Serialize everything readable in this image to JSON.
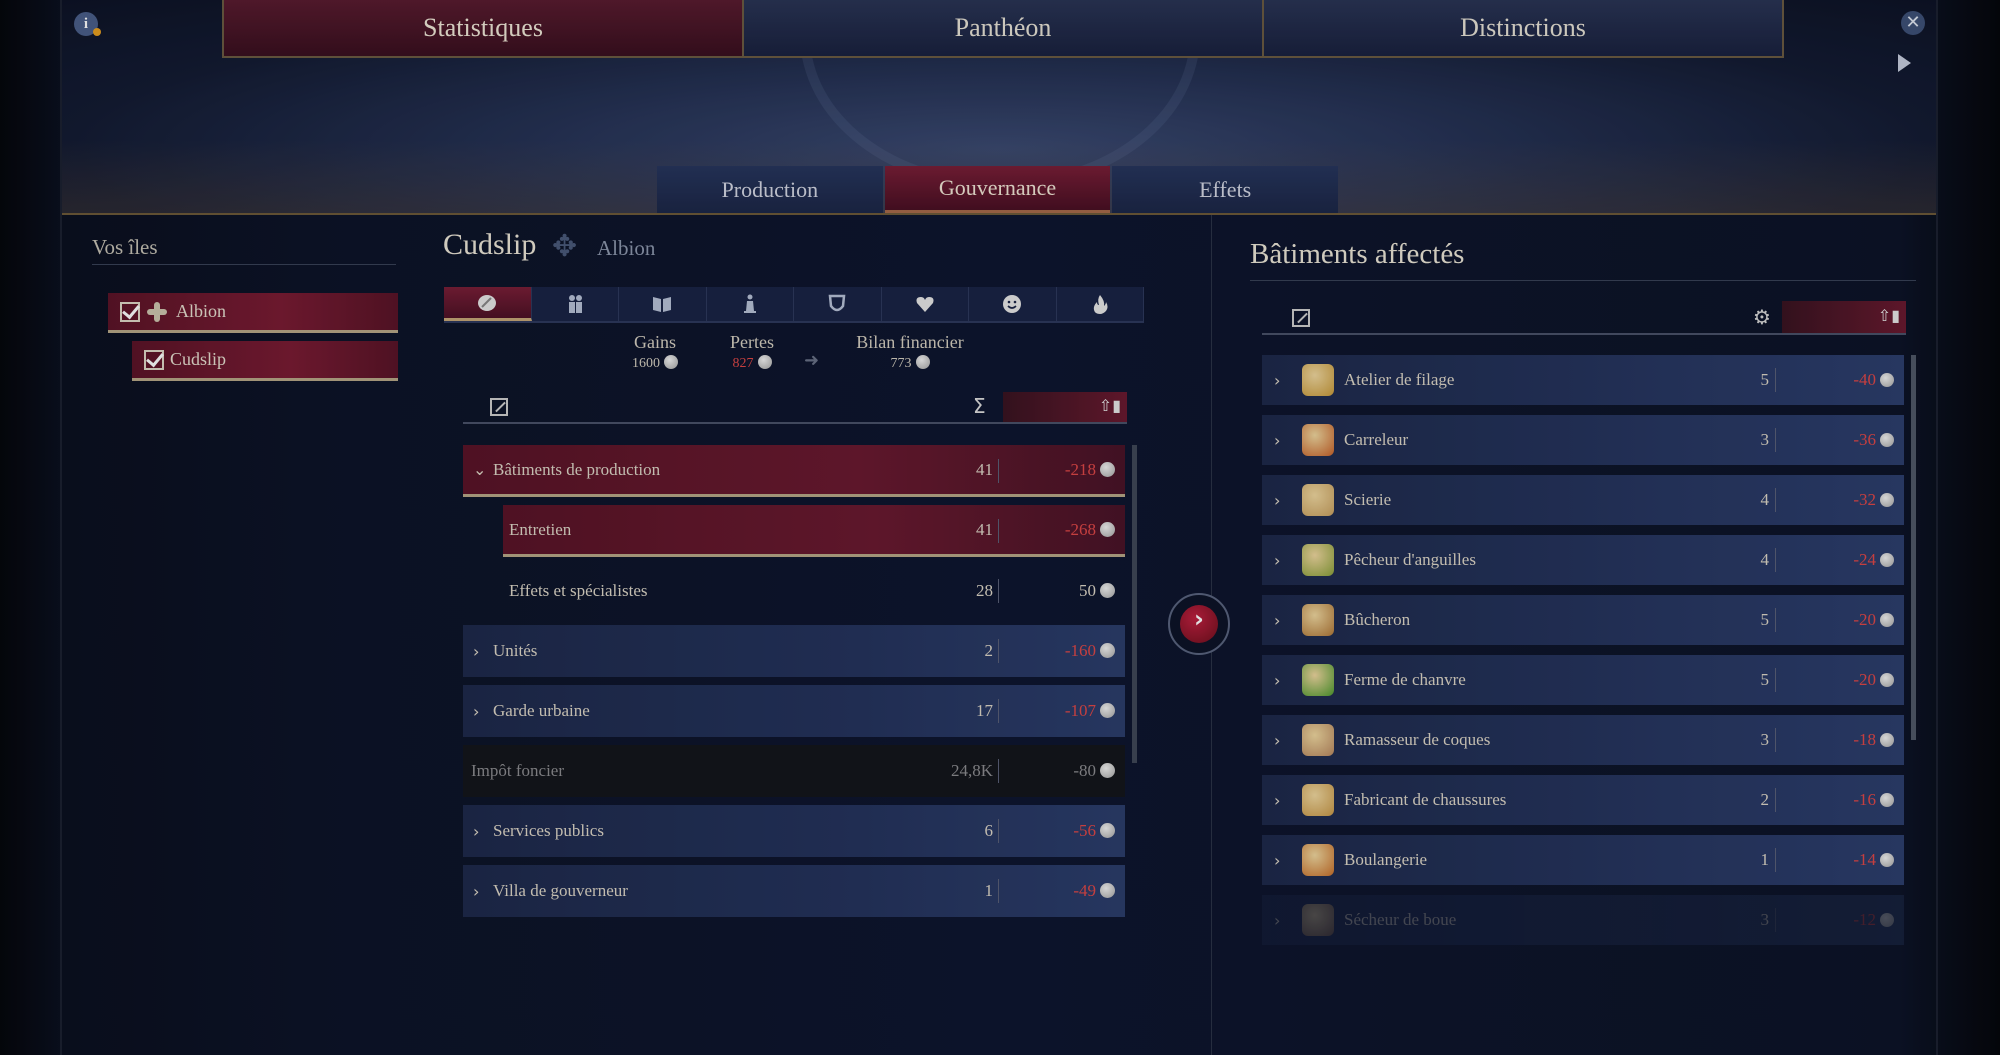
{
  "header": {
    "top_tabs": [
      {
        "label": "Statistiques",
        "active": true
      },
      {
        "label": "Panthéon",
        "active": false
      },
      {
        "label": "Distinctions",
        "active": false
      }
    ],
    "sub_tabs": [
      {
        "label": "Production",
        "active": false
      },
      {
        "label": "Gouvernance",
        "active": true
      },
      {
        "label": "Effets",
        "active": false
      }
    ],
    "info_icon": "i",
    "close_icon": "close-icon",
    "next_icon": "play-icon"
  },
  "sidebar": {
    "title": "Vos îles",
    "islands": [
      {
        "name": "Albion",
        "checked": true,
        "icon": "cross-icon"
      },
      {
        "name": "Cudslip",
        "checked": true
      }
    ]
  },
  "center": {
    "city_name": "Cudslip",
    "region": "Albion",
    "categories": [
      "coin-icon",
      "workforce-icon",
      "book-icon",
      "tower-icon",
      "shield-icon",
      "heart-icon",
      "smile-icon",
      "fire-icon"
    ],
    "summary": {
      "gains_label": "Gains",
      "gains_value": "1600",
      "losses_label": "Pertes",
      "losses_value": "827",
      "balance_label": "Bilan financier",
      "balance_value": "773"
    },
    "table_header": {
      "sigma": "Σ",
      "sort_icon": "sort-up-icon"
    },
    "rows": [
      {
        "label": "Bâtiments de production",
        "count": "41",
        "value": "-218",
        "negative": true,
        "expanded": true
      },
      {
        "label": "Entretien",
        "count": "41",
        "value": "-268",
        "negative": true
      },
      {
        "label": "Effets et spécialistes",
        "count": "28",
        "value": "50",
        "negative": false
      },
      {
        "label": "Unités",
        "count": "2",
        "value": "-160",
        "negative": true
      },
      {
        "label": "Garde urbaine",
        "count": "17",
        "value": "-107",
        "negative": true
      },
      {
        "label": "Impôt foncier",
        "count": "24,8K",
        "value": "-80",
        "negative": false
      },
      {
        "label": "Services publics",
        "count": "6",
        "value": "-56",
        "negative": true
      },
      {
        "label": "Villa de gouverneur",
        "count": "1",
        "value": "-49",
        "negative": true
      }
    ]
  },
  "right": {
    "title": "Bâtiments affectés",
    "buildings": [
      {
        "name": "Atelier de filage",
        "count": "5",
        "value": "-40",
        "color": "#c89a3a"
      },
      {
        "name": "Carreleur",
        "count": "3",
        "value": "-36",
        "color": "#c8632a"
      },
      {
        "name": "Scierie",
        "count": "4",
        "value": "-32",
        "color": "#c8a060"
      },
      {
        "name": "Pêcheur d'anguilles",
        "count": "4",
        "value": "-24",
        "color": "#8aa03a"
      },
      {
        "name": "Bûcheron",
        "count": "5",
        "value": "-20",
        "color": "#b07838"
      },
      {
        "name": "Ferme de chanvre",
        "count": "5",
        "value": "-20",
        "color": "#4e9a2e"
      },
      {
        "name": "Ramasseur de coques",
        "count": "3",
        "value": "-18",
        "color": "#b88860"
      },
      {
        "name": "Fabricant de chaussures",
        "count": "2",
        "value": "-16",
        "color": "#c89848"
      },
      {
        "name": "Boulangerie",
        "count": "1",
        "value": "-14",
        "color": "#c8702a"
      },
      {
        "name": "Sécheur de boue",
        "count": "3",
        "value": "-12",
        "color": "#806048"
      }
    ]
  }
}
